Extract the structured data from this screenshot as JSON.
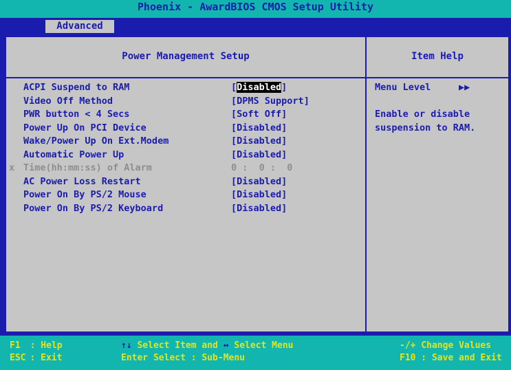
{
  "title": "Phoenix - AwardBIOS CMOS Setup Utility",
  "menu": {
    "active_tab": "Advanced"
  },
  "panel": {
    "heading": "Power Management Setup",
    "help_heading": "Item Help"
  },
  "settings": [
    {
      "mark": "",
      "label": "ACPI Suspend to RAM",
      "value_open": "[",
      "value": "Disabled",
      "value_close": "]",
      "state": "selected"
    },
    {
      "mark": "",
      "label": "Video Off Method",
      "value_open": "[",
      "value": "DPMS Support",
      "value_close": "]",
      "state": "normal"
    },
    {
      "mark": "",
      "label": "PWR button < 4 Secs",
      "value_open": "[",
      "value": "Soft Off",
      "value_close": "]",
      "state": "normal"
    },
    {
      "mark": "",
      "label": "Power Up On PCI Device",
      "value_open": "[",
      "value": "Disabled",
      "value_close": "]",
      "state": "normal"
    },
    {
      "mark": "",
      "label": "Wake/Power Up On Ext.Modem",
      "value_open": "[",
      "value": "Disabled",
      "value_close": "]",
      "state": "normal"
    },
    {
      "mark": "",
      "label": "Automatic Power Up",
      "value_open": "[",
      "value": "Disabled",
      "value_close": "]",
      "state": "normal"
    },
    {
      "mark": "x",
      "label": "Time(hh:mm:ss) of Alarm",
      "value_open": "",
      "value": "0 :  0 :  0",
      "value_close": "",
      "state": "disabled"
    },
    {
      "mark": "",
      "label": "AC Power Loss Restart",
      "value_open": "[",
      "value": "Disabled",
      "value_close": "]",
      "state": "normal"
    },
    {
      "mark": "",
      "label": "Power On By PS/2 Mouse",
      "value_open": "[",
      "value": "Disabled",
      "value_close": "]",
      "state": "normal"
    },
    {
      "mark": "",
      "label": "Power On By PS/2 Keyboard",
      "value_open": "[",
      "value": "Disabled",
      "value_close": "]",
      "state": "normal"
    }
  ],
  "help": {
    "menu_level_label": "Menu Level",
    "menu_level_icon": "double-right-arrow",
    "menu_level_glyph": "▶▶",
    "text": "Enable or disable\nsuspension to RAM."
  },
  "status_bar": {
    "f1_key": "F1",
    "f1_desc": ": Help",
    "esc_key": "ESC",
    "esc_desc": ": Exit",
    "select_item_arrows": "↑↓",
    "select_item": " Select Item and ",
    "select_menu_arrows": "↔",
    "select_menu": " Select Menu",
    "enter_line": "Enter Select : Sub-Menu",
    "change_values": "-/+ Change Values",
    "f10_line": "F10 : Save and Exit"
  },
  "colors": {
    "bios_blue": "#1a1cae",
    "bios_gray": "#c6c6c6",
    "bios_cyan": "#13b6ae",
    "bios_yellow": "#e4e41a"
  }
}
